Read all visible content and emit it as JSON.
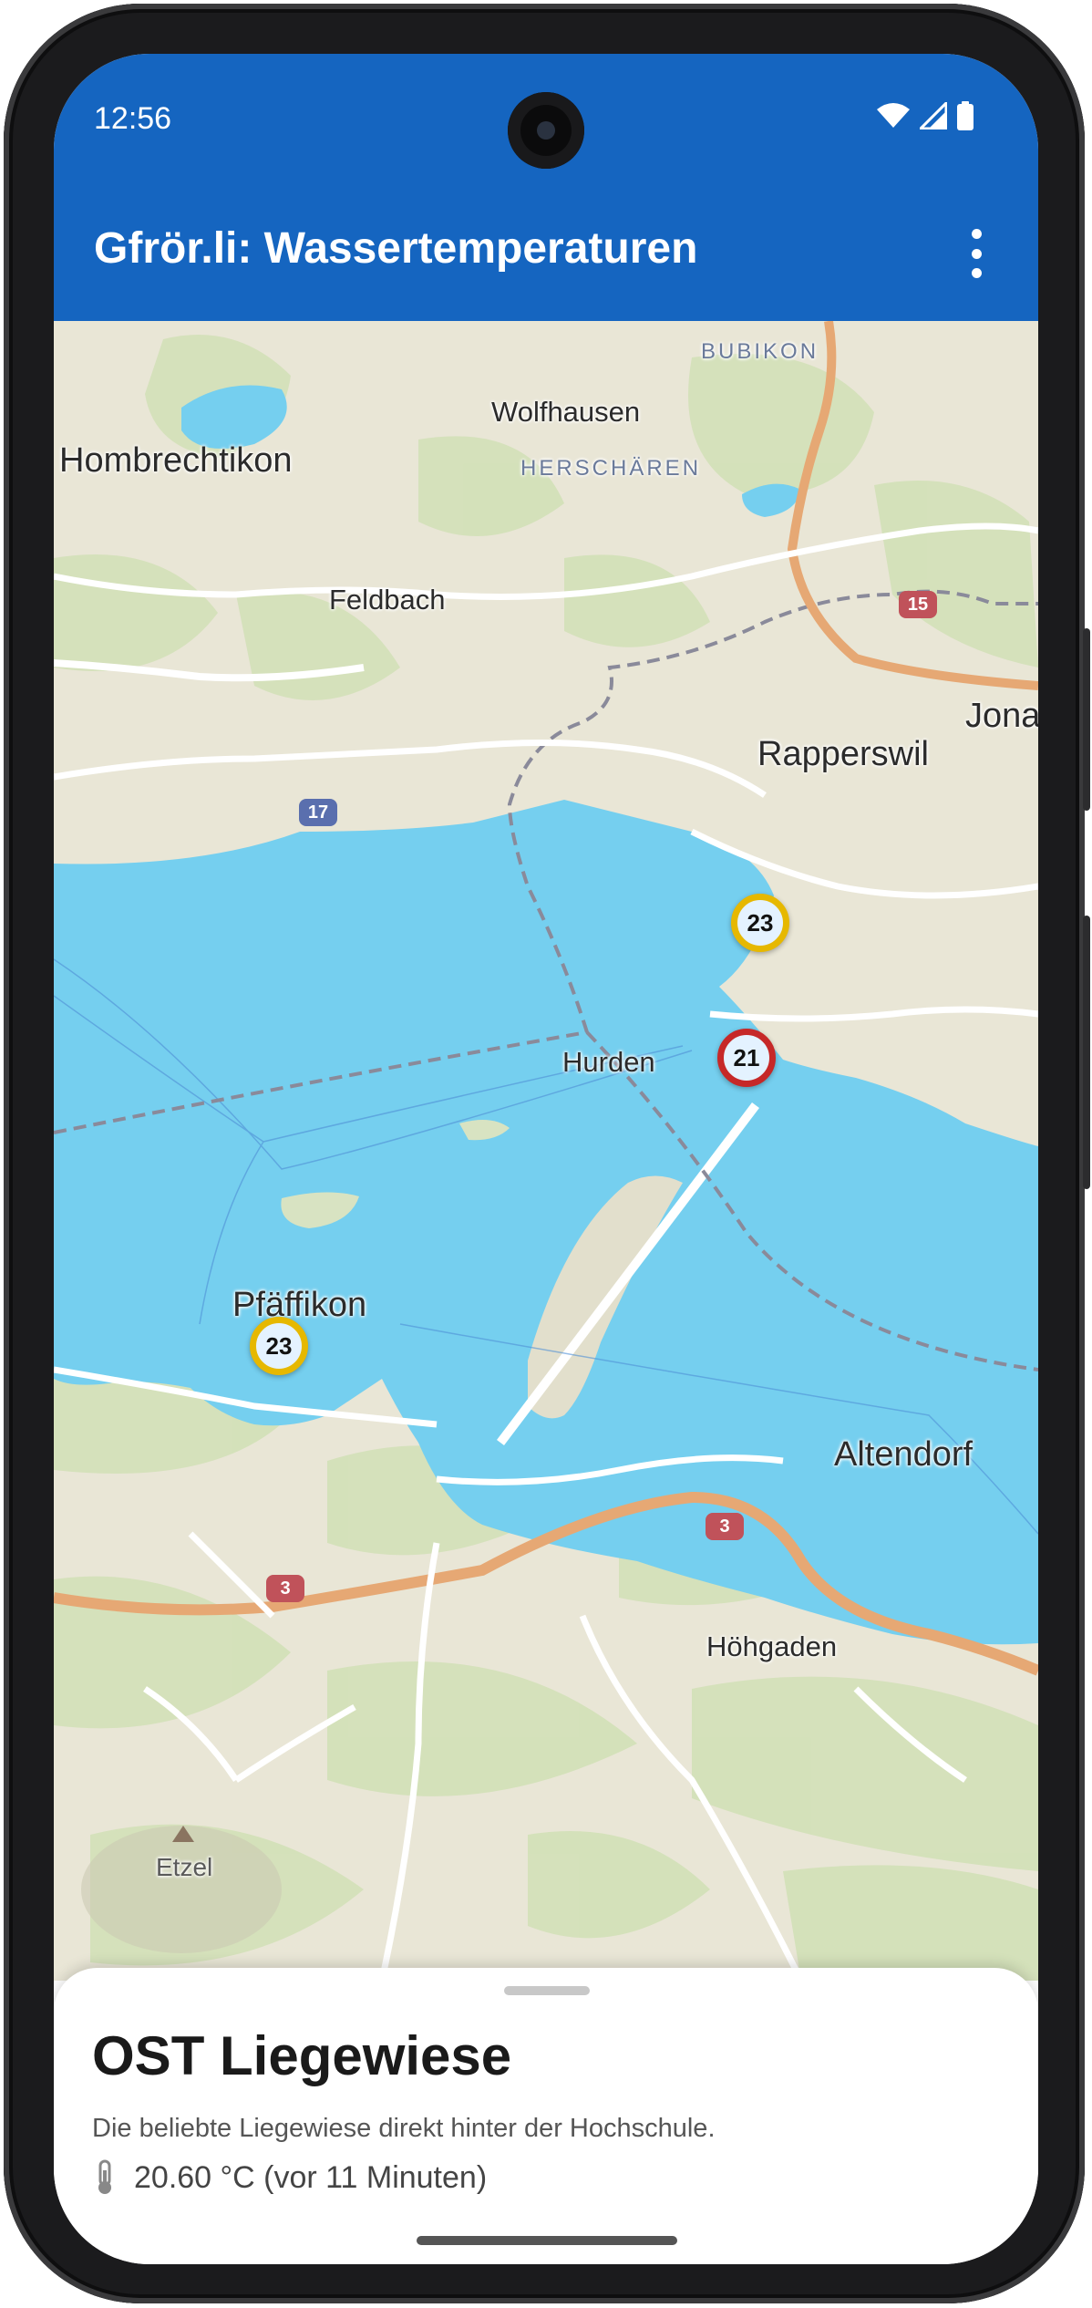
{
  "status_bar": {
    "time": "12:56",
    "icons": [
      "wifi-icon",
      "cellular-signal-icon",
      "battery-icon"
    ]
  },
  "app_bar": {
    "title": "Gfrör.li: Wassertemperaturen",
    "menu_icon": "more-vert-icon",
    "color": "#1565c0"
  },
  "map": {
    "labels": {
      "bubikon": "BUBIKON",
      "wolfhausen": "Wolfhausen",
      "herscharen": "HERSCHÄREN",
      "hombrechtikon": "Hombrechtikon",
      "feldbach": "Feldbach",
      "rapperswil": "Rapperswil",
      "jona": "Jona",
      "hurden": "Hurden",
      "pfaffikon": "Pfäffikon",
      "altendorf": "Altendorf",
      "hohgaden": "Höhgaden",
      "etzel": "Etzel"
    },
    "road_badges": {
      "r15": "15",
      "r17": "17",
      "r3a": "3",
      "r3b": "3"
    },
    "markers": [
      {
        "value": "23",
        "color": "#e6b800"
      },
      {
        "value": "21",
        "color": "#c62828"
      },
      {
        "value": "23",
        "color": "#e6b800"
      }
    ],
    "water_color": "#75cfef",
    "land_color": "#e9e5d8"
  },
  "sheet": {
    "title": "OST Liegewiese",
    "description": "Die beliebte Liegewiese direkt hinter der Hochschule.",
    "temperature": "20.60 °C (vor 11 Minuten)",
    "temp_icon": "thermometer-icon"
  }
}
